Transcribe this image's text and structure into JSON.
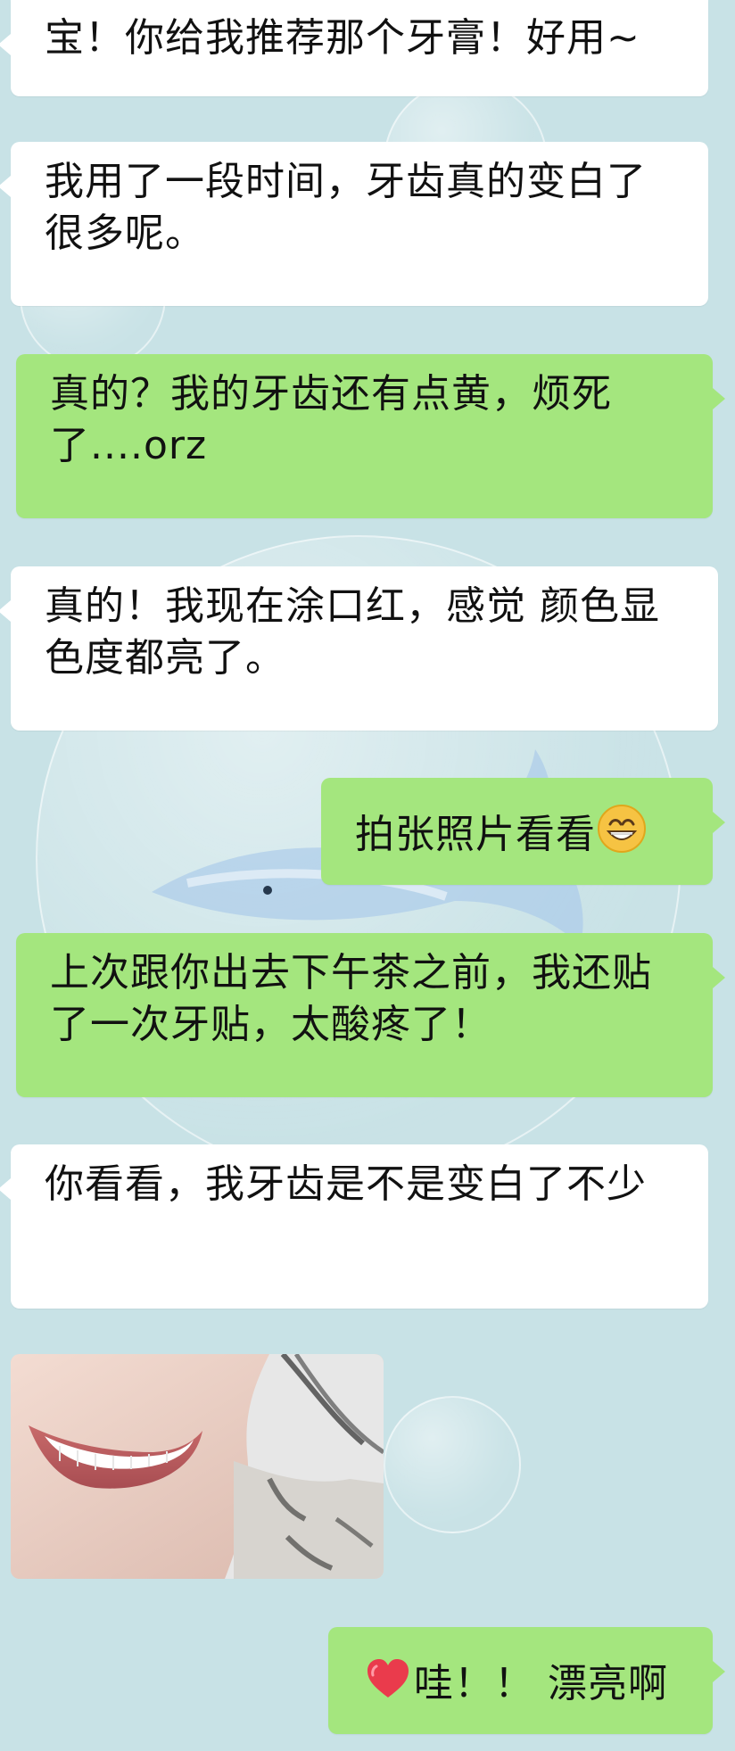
{
  "chat": {
    "messages": [
      {
        "id": "m1",
        "side": "received",
        "text": "宝！你给我推荐那个牙膏！好用~"
      },
      {
        "id": "m2",
        "side": "received",
        "text": "我用了一段时间，牙齿真的变白了很多呢。"
      },
      {
        "id": "m3",
        "side": "sent",
        "text": "真的？我的牙齿还有点黄，烦死了....orz"
      },
      {
        "id": "m4",
        "side": "received",
        "text": "真的！我现在涂口红，感觉 颜色显色度都亮了。"
      },
      {
        "id": "m5",
        "side": "sent",
        "text": "拍张照片看看",
        "emoji": "grinning-face-icon"
      },
      {
        "id": "m6",
        "side": "sent",
        "text": "上次跟你出去下午茶之前，我还贴了一次牙贴，太酸疼了！"
      },
      {
        "id": "m7",
        "side": "received",
        "text": "你看看，我牙齿是不是变白了不少"
      },
      {
        "id": "m8",
        "side": "received",
        "type": "image",
        "content": "smiling-mouth-photo"
      },
      {
        "id": "m9",
        "side": "sent",
        "text": "哇！！ 漂亮啊",
        "emoji": "red-heart-icon"
      }
    ]
  },
  "colors": {
    "background": "#c8e2e6",
    "received_bubble": "#ffffff",
    "sent_bubble": "#a4e67e"
  }
}
